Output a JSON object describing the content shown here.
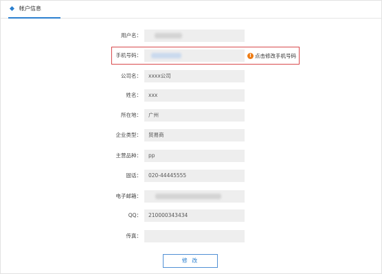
{
  "tab": {
    "label": "帐户信息"
  },
  "form": {
    "fields": [
      {
        "label": "用户名：",
        "value": ""
      },
      {
        "label": "手机号码：",
        "value": ""
      },
      {
        "label": "公司名：",
        "value": "xxxx公司"
      },
      {
        "label": "姓名：",
        "value": "xxx"
      },
      {
        "label": "所在地：",
        "value": "广州"
      },
      {
        "label": "企业类型：",
        "value": "贸易商"
      },
      {
        "label": "主营品种：",
        "value": "pp"
      },
      {
        "label": "固话：",
        "value": "020-44445555"
      },
      {
        "label": "电子邮箱：",
        "value": ""
      },
      {
        "label": "QQ：",
        "value": "210000343434"
      },
      {
        "label": "传真：",
        "value": ""
      }
    ],
    "phone_hint": "点击修改手机号码",
    "warning_symbol": "!",
    "submit_label": "修 改"
  },
  "colors": {
    "accent": "#2a7fcf",
    "highlight_border": "#d8484b",
    "warning": "#ee7b12",
    "field_bg": "#eeeeee"
  },
  "icons": {
    "tab_marker": "diamond-icon",
    "hint_marker": "warning-icon"
  }
}
